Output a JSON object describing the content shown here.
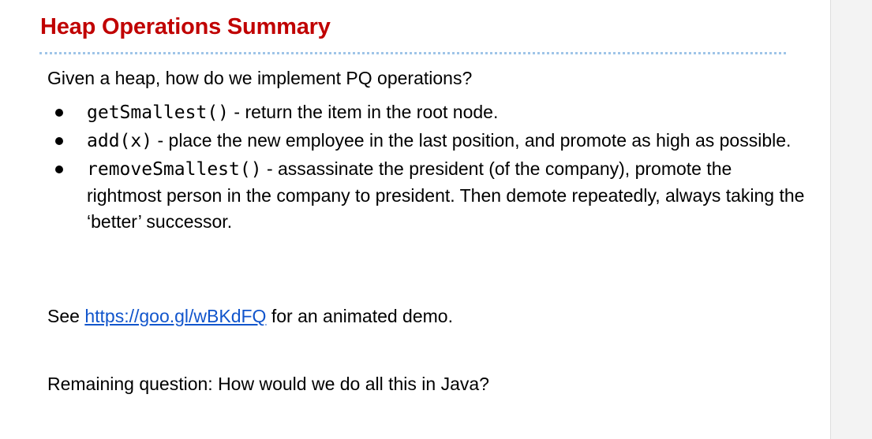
{
  "slide": {
    "title": "Heap Operations Summary",
    "intro": "Given a heap, how do we implement PQ operations?",
    "bullets": [
      {
        "code": "getSmallest()",
        "text": " - return the item in the root node."
      },
      {
        "code": "add(x)",
        "text": " - place the new employee in the last position, and promote as high as possible."
      },
      {
        "code": "removeSmallest()",
        "text": " - assassinate the president (of the company), promote the rightmost person in the company to president. Then demote repeatedly, always taking the ‘better’ successor."
      }
    ],
    "see_prefix": "See ",
    "link_text": "https://goo.gl/wBKdFQ",
    "see_suffix": " for an animated demo.",
    "remaining": "Remaining question: How would we do all this in Java?"
  },
  "colors": {
    "title": "#c00000",
    "link": "#1155cc",
    "divider": "#9fc5e8"
  }
}
